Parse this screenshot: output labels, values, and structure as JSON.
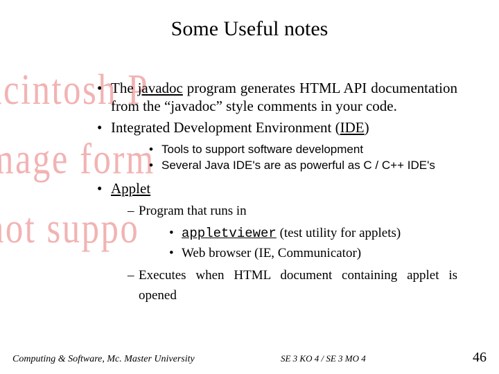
{
  "bg": {
    "line1": "acintosh P",
    "line2": "mage form",
    "line3": "not suppo"
  },
  "title": "Some Useful notes",
  "bullets": {
    "b1a": "The ",
    "b1b": "javadoc",
    "b1c": " program generates HTML API documentation from the “javadoc” style comments in your code.",
    "b2a": "Integrated Development Environment (",
    "b2b": "IDE",
    "b2c": ")",
    "b2s1": "Tools to support software development",
    "b2s2": "Several Java IDE's are as powerful as C / C++ IDE's",
    "b3": "Applet",
    "b3d1": "Program that runs in",
    "b3d1s1a": "appletviewer",
    "b3d1s1b": " (test utility for applets)",
    "b3d1s2": " Web browser (IE, Communicator)",
    "b3d2": "Executes when HTML document containing applet is opened"
  },
  "footer": {
    "left": "Computing & Software, Mc. Master University",
    "center": "SE 3 KO 4 / SE 3 MO 4",
    "right": "46"
  }
}
